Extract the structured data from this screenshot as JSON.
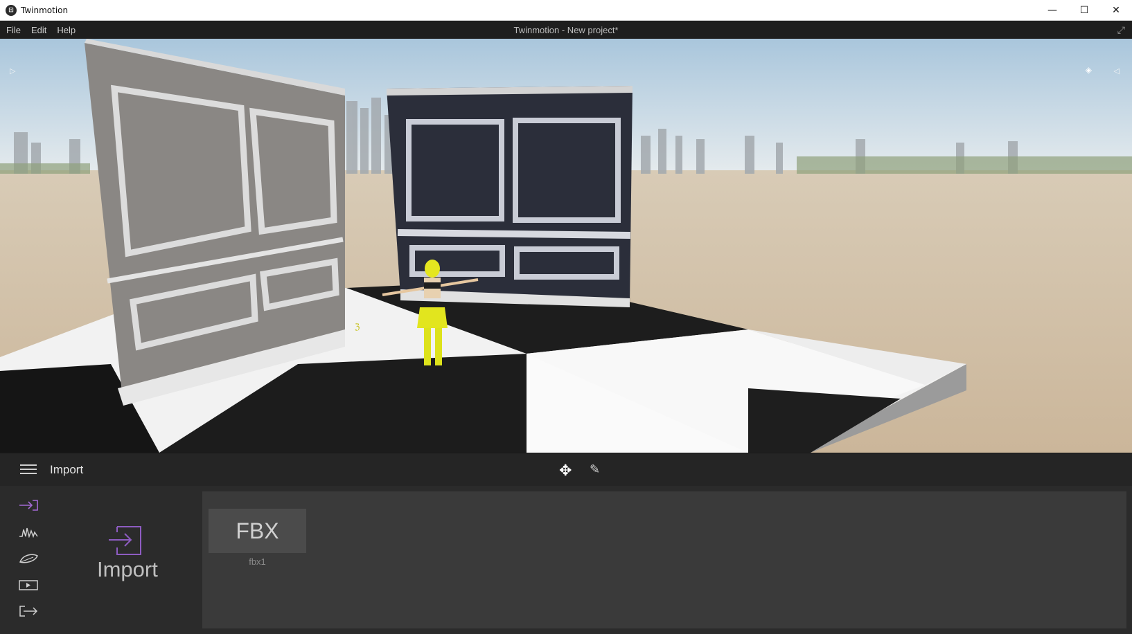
{
  "window": {
    "app_name": "Twinmotion",
    "app_icon": "twinmotion-logo-icon",
    "controls": {
      "minimize": "—",
      "maximize": "☐",
      "close": "✕"
    }
  },
  "menubar": {
    "items": [
      "File",
      "Edit",
      "Help"
    ],
    "project_title": "Twinmotion - New project*",
    "expand_icon": "⤢"
  },
  "viewport": {
    "left_arrow": "▷",
    "eye_icon": "◈",
    "right_arrow": "◁"
  },
  "toolbar": {
    "section_title": "Import",
    "move_icon": "✥",
    "pen_icon": "✎"
  },
  "side_nav": {
    "icons": [
      {
        "name": "import-nav-icon",
        "glyph": "⇥",
        "color": "#a56ad6"
      },
      {
        "name": "context-nav-icon",
        "glyph": "⋀⋀",
        "color": "#cfcfcf"
      },
      {
        "name": "lifecycle-nav-icon",
        "glyph": "⌬",
        "color": "#cfcfcf"
      },
      {
        "name": "media-nav-icon",
        "glyph": "▷",
        "color": "#cfcfcf"
      },
      {
        "name": "export-nav-icon",
        "glyph": "⇨",
        "color": "#cfcfcf"
      }
    ]
  },
  "import_panel": {
    "big_label": "Import",
    "accent_color": "#8e5cc2",
    "files": [
      {
        "format": "FBX",
        "name": "fbx1"
      }
    ]
  }
}
